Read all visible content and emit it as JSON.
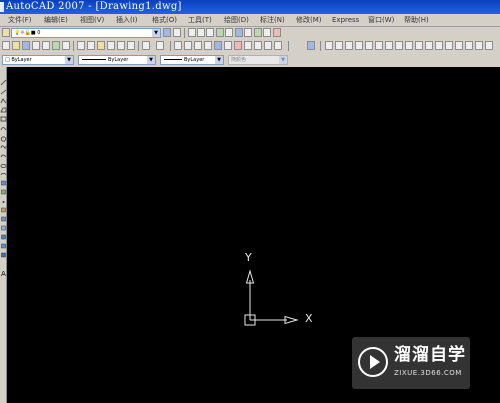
{
  "window": {
    "title": "AutoCAD 2007 - [Drawing1.dwg]"
  },
  "menu": [
    "文件(F)",
    "编辑(E)",
    "视图(V)",
    "插入(I)",
    "格式(O)",
    "工具(T)",
    "绘图(D)",
    "标注(N)",
    "修改(M)",
    "Express",
    "窗口(W)",
    "帮助(H)"
  ],
  "layers": {
    "current": "0"
  },
  "properties": {
    "color": "ByLayer",
    "linetype": "ByLayer",
    "lineweight": "ByLayer",
    "plotstyle": "随颜色"
  },
  "ucs": {
    "x_label": "X",
    "y_label": "Y"
  },
  "watermark": {
    "name": "溜溜自学",
    "url": "ZIXUE.3D66.COM"
  },
  "colors": {
    "canvas": "#000000",
    "ucs": "#e8e8e8",
    "title_bar": "#0a3fbd",
    "toolbar": "#d4d0c8"
  }
}
